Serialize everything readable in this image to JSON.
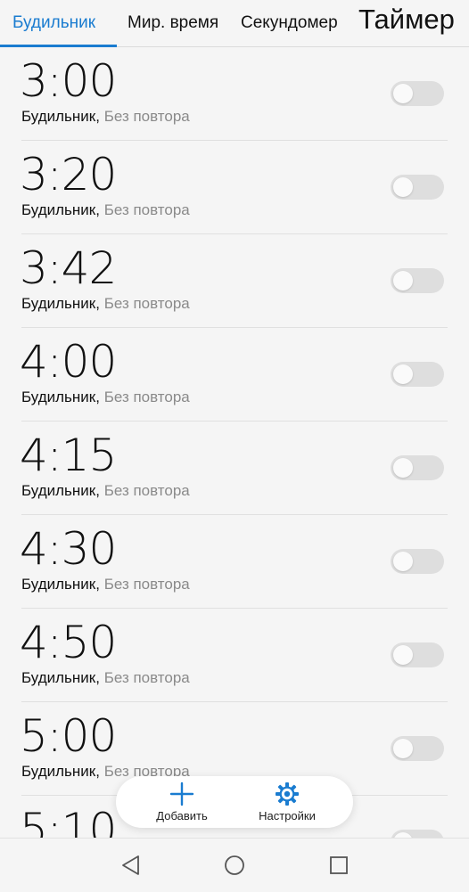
{
  "tabs": [
    {
      "label": "Будильник",
      "active": true
    },
    {
      "label": "Мир. время",
      "active": false
    },
    {
      "label": "Секундомер",
      "active": false
    },
    {
      "label": "Таймер",
      "active": false
    }
  ],
  "alarms": [
    {
      "time": "3:00",
      "label": "Будильник,",
      "repeat": "Без повтора",
      "enabled": false
    },
    {
      "time": "3:20",
      "label": "Будильник,",
      "repeat": "Без повтора",
      "enabled": false
    },
    {
      "time": "3:42",
      "label": "Будильник,",
      "repeat": "Без повтора",
      "enabled": false
    },
    {
      "time": "4:00",
      "label": "Будильник,",
      "repeat": "Без повтора",
      "enabled": false
    },
    {
      "time": "4:15",
      "label": "Будильник,",
      "repeat": "Без повтора",
      "enabled": false
    },
    {
      "time": "4:30",
      "label": "Будильник,",
      "repeat": "Без повтора",
      "enabled": false
    },
    {
      "time": "4:50",
      "label": "Будильник,",
      "repeat": "Без повтора",
      "enabled": false
    },
    {
      "time": "5:00",
      "label": "Будильник,",
      "repeat": "Без повтора",
      "enabled": false
    },
    {
      "time": "5:10",
      "label": "",
      "repeat": "",
      "enabled": false
    }
  ],
  "actions": {
    "add_label": "Добавить",
    "add_icon": "plus-icon",
    "settings_label": "Настройки",
    "settings_icon": "gear-icon"
  },
  "navbar": {
    "back_icon": "back-triangle-icon",
    "home_icon": "home-circle-icon",
    "recent_icon": "recent-square-icon"
  },
  "colors": {
    "accent": "#1a7cd0",
    "background": "#f5f5f5",
    "toggle_off": "#dedede",
    "secondary_text": "#8a8a8a"
  }
}
